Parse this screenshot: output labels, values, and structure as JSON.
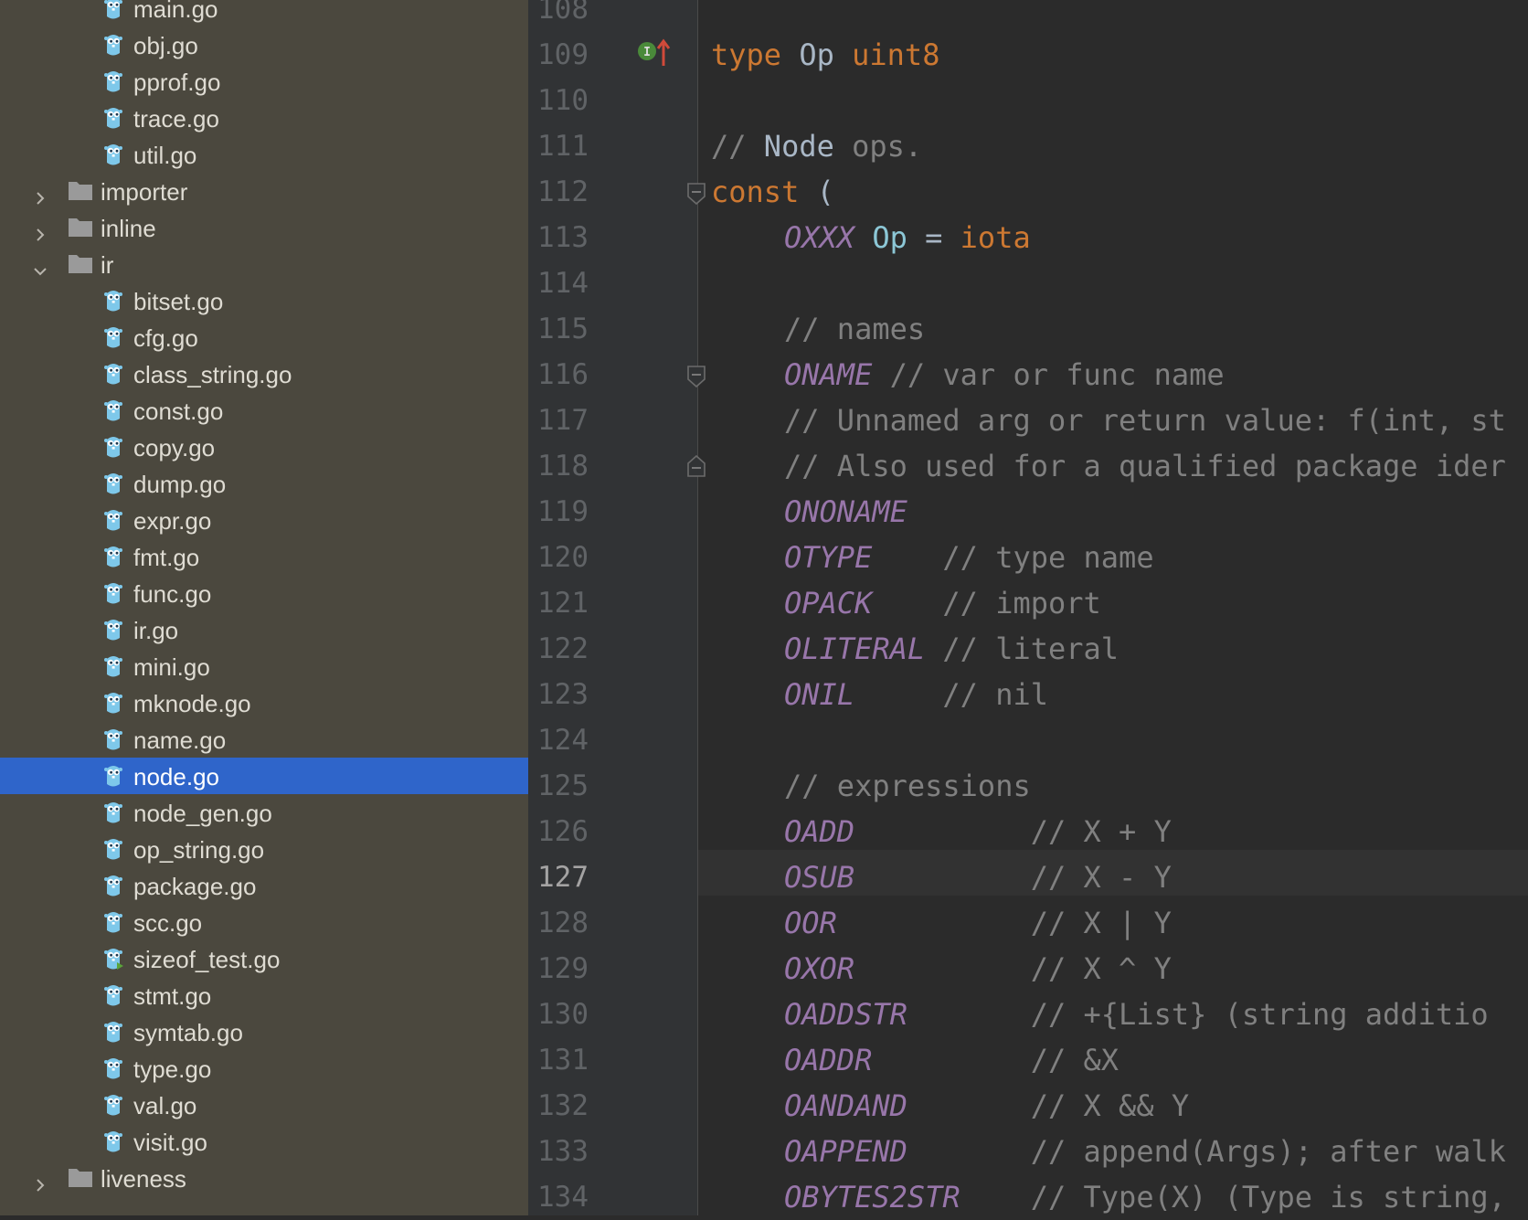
{
  "tree": {
    "files_top": [
      "main.go",
      "obj.go",
      "pprof.go",
      "trace.go",
      "util.go"
    ],
    "folders_closed": [
      "importer",
      "inline"
    ],
    "folder_open": "ir",
    "ir_files": [
      "bitset.go",
      "cfg.go",
      "class_string.go",
      "const.go",
      "copy.go",
      "dump.go",
      "expr.go",
      "fmt.go",
      "func.go",
      "ir.go",
      "mini.go",
      "mknode.go",
      "name.go",
      "node.go",
      "node_gen.go",
      "op_string.go",
      "package.go",
      "scc.go",
      "sizeof_test.go",
      "stmt.go",
      "symtab.go",
      "type.go",
      "val.go",
      "visit.go"
    ],
    "selected_file": "node.go",
    "folder_after": "liveness"
  },
  "editor": {
    "current_line": "127",
    "line_numbers": [
      "108",
      "109",
      "110",
      "111",
      "112",
      "113",
      "114",
      "115",
      "116",
      "117",
      "118",
      "119",
      "120",
      "121",
      "122",
      "123",
      "124",
      "125",
      "126",
      "127",
      "128",
      "129",
      "130",
      "131",
      "132",
      "133",
      "134"
    ],
    "code": {
      "l109": {
        "kw": "type",
        "name": "Op",
        "type": "uint8"
      },
      "l111": {
        "c1": "// ",
        "c2": "Node",
        "c3": " ops."
      },
      "l112": {
        "kw": "const",
        "paren": " ("
      },
      "l113": {
        "const": "OXXX",
        "type": "Op",
        "eq": " = ",
        "iota": "iota"
      },
      "l115": {
        "comment": "// names"
      },
      "l116": {
        "const": "ONAME",
        "comment": " // var or func name"
      },
      "l117": {
        "comment": "// Unnamed arg or return value: f(int, st"
      },
      "l118": {
        "comment": "// Also used for a qualified package ider"
      },
      "l119": {
        "const": "ONONAME"
      },
      "l120": {
        "const": "OTYPE",
        "comment": "    // type name"
      },
      "l121": {
        "const": "OPACK",
        "comment": "    // import"
      },
      "l122": {
        "const": "OLITERAL",
        "comment": " // literal"
      },
      "l123": {
        "const": "ONIL",
        "comment": "     // nil"
      },
      "l125": {
        "comment": "// expressions"
      },
      "l126": {
        "const": "OADD",
        "comment": "          // X + Y"
      },
      "l127": {
        "const": "OSUB",
        "comment": "          // X - Y"
      },
      "l128": {
        "const": "OOR",
        "comment": "           // X | Y"
      },
      "l129": {
        "const": "OXOR",
        "comment": "          // X ^ Y"
      },
      "l130": {
        "const": "OADDSTR",
        "comment": "       // +{List} (string additio"
      },
      "l131": {
        "const": "OADDR",
        "comment": "         // &X"
      },
      "l132": {
        "const": "OANDAND",
        "comment": "       // X && Y"
      },
      "l133": {
        "const": "OAPPEND",
        "comment": "       // append(Args); after walk"
      },
      "l134": {
        "const": "OBYTES2STR",
        "comment": "    // Type(X) (Type is string,"
      }
    },
    "colors": {
      "keyword": "#cc7832",
      "constant": "#9876aa",
      "comment": "#808080",
      "type": "#8cc7d6",
      "selection": "#2f65ca"
    }
  }
}
